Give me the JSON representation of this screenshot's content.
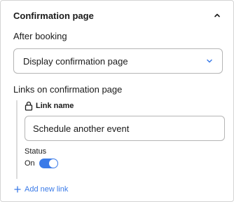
{
  "section": {
    "title": "Confirmation page",
    "collapse_icon": "chevron-up-icon"
  },
  "after_booking": {
    "label": "After booking",
    "selected": "Display confirmation page",
    "dropdown_icon": "chevron-down-icon"
  },
  "links": {
    "label": "Links on confirmation page",
    "items": [
      {
        "name_label": "Link name",
        "lock_icon": "lock-icon",
        "value": "Schedule another event",
        "status_label": "Status",
        "status_value": "On",
        "enabled": true
      }
    ],
    "add_label": "Add new link",
    "add_icon": "plus-icon"
  },
  "colors": {
    "accent": "#3b7be8",
    "border": "#b5b5b5",
    "text": "#1a1a1a"
  }
}
